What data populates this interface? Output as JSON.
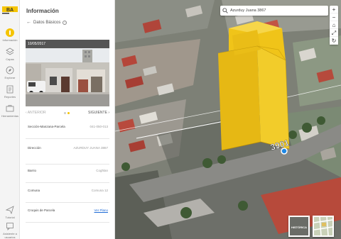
{
  "app": {
    "logo_text": "BA"
  },
  "rail": {
    "items": [
      {
        "label": "Información",
        "icon": "info-icon",
        "active": true
      },
      {
        "label": "Capas",
        "icon": "layers-icon"
      },
      {
        "label": "Explorar",
        "icon": "compass-icon"
      },
      {
        "label": "Reportes",
        "icon": "report-icon"
      },
      {
        "label": "Herramientas",
        "icon": "tools-icon"
      },
      {
        "label": "Tutorial",
        "icon": "paper-plane-icon"
      },
      {
        "label": "Asistente a usuarios",
        "icon": "chat-icon"
      }
    ]
  },
  "panel": {
    "title": "Información",
    "subtitle": "Datos Básicos",
    "photo_date": "10/05/2017",
    "prev_label": "ANTERIOR",
    "next_label": "SIGUIENTE",
    "rows": [
      {
        "key": "Sección-Manzana-Parcela",
        "value": "041-050-013",
        "link": false
      },
      {
        "key": "Dirección",
        "value": "AZURDUY JUANA 3867",
        "link": false
      },
      {
        "key": "Barrio",
        "value": "Coghlan",
        "link": false
      },
      {
        "key": "Comuna",
        "value": "Comuna 12",
        "link": false
      },
      {
        "key": "Croquis de Parcela",
        "value": "Ver Plano",
        "link": true
      }
    ]
  },
  "map": {
    "search_value": "Azurduy Juana 3867",
    "address_number": "3901",
    "controls": [
      "+",
      "−",
      "⌂",
      "⤢",
      "↻"
    ],
    "thumbs": [
      {
        "label": "HISTÓRICA"
      },
      {
        "label": ""
      }
    ],
    "colors": {
      "building": "#f0c419",
      "accent": "#f5c400"
    }
  }
}
